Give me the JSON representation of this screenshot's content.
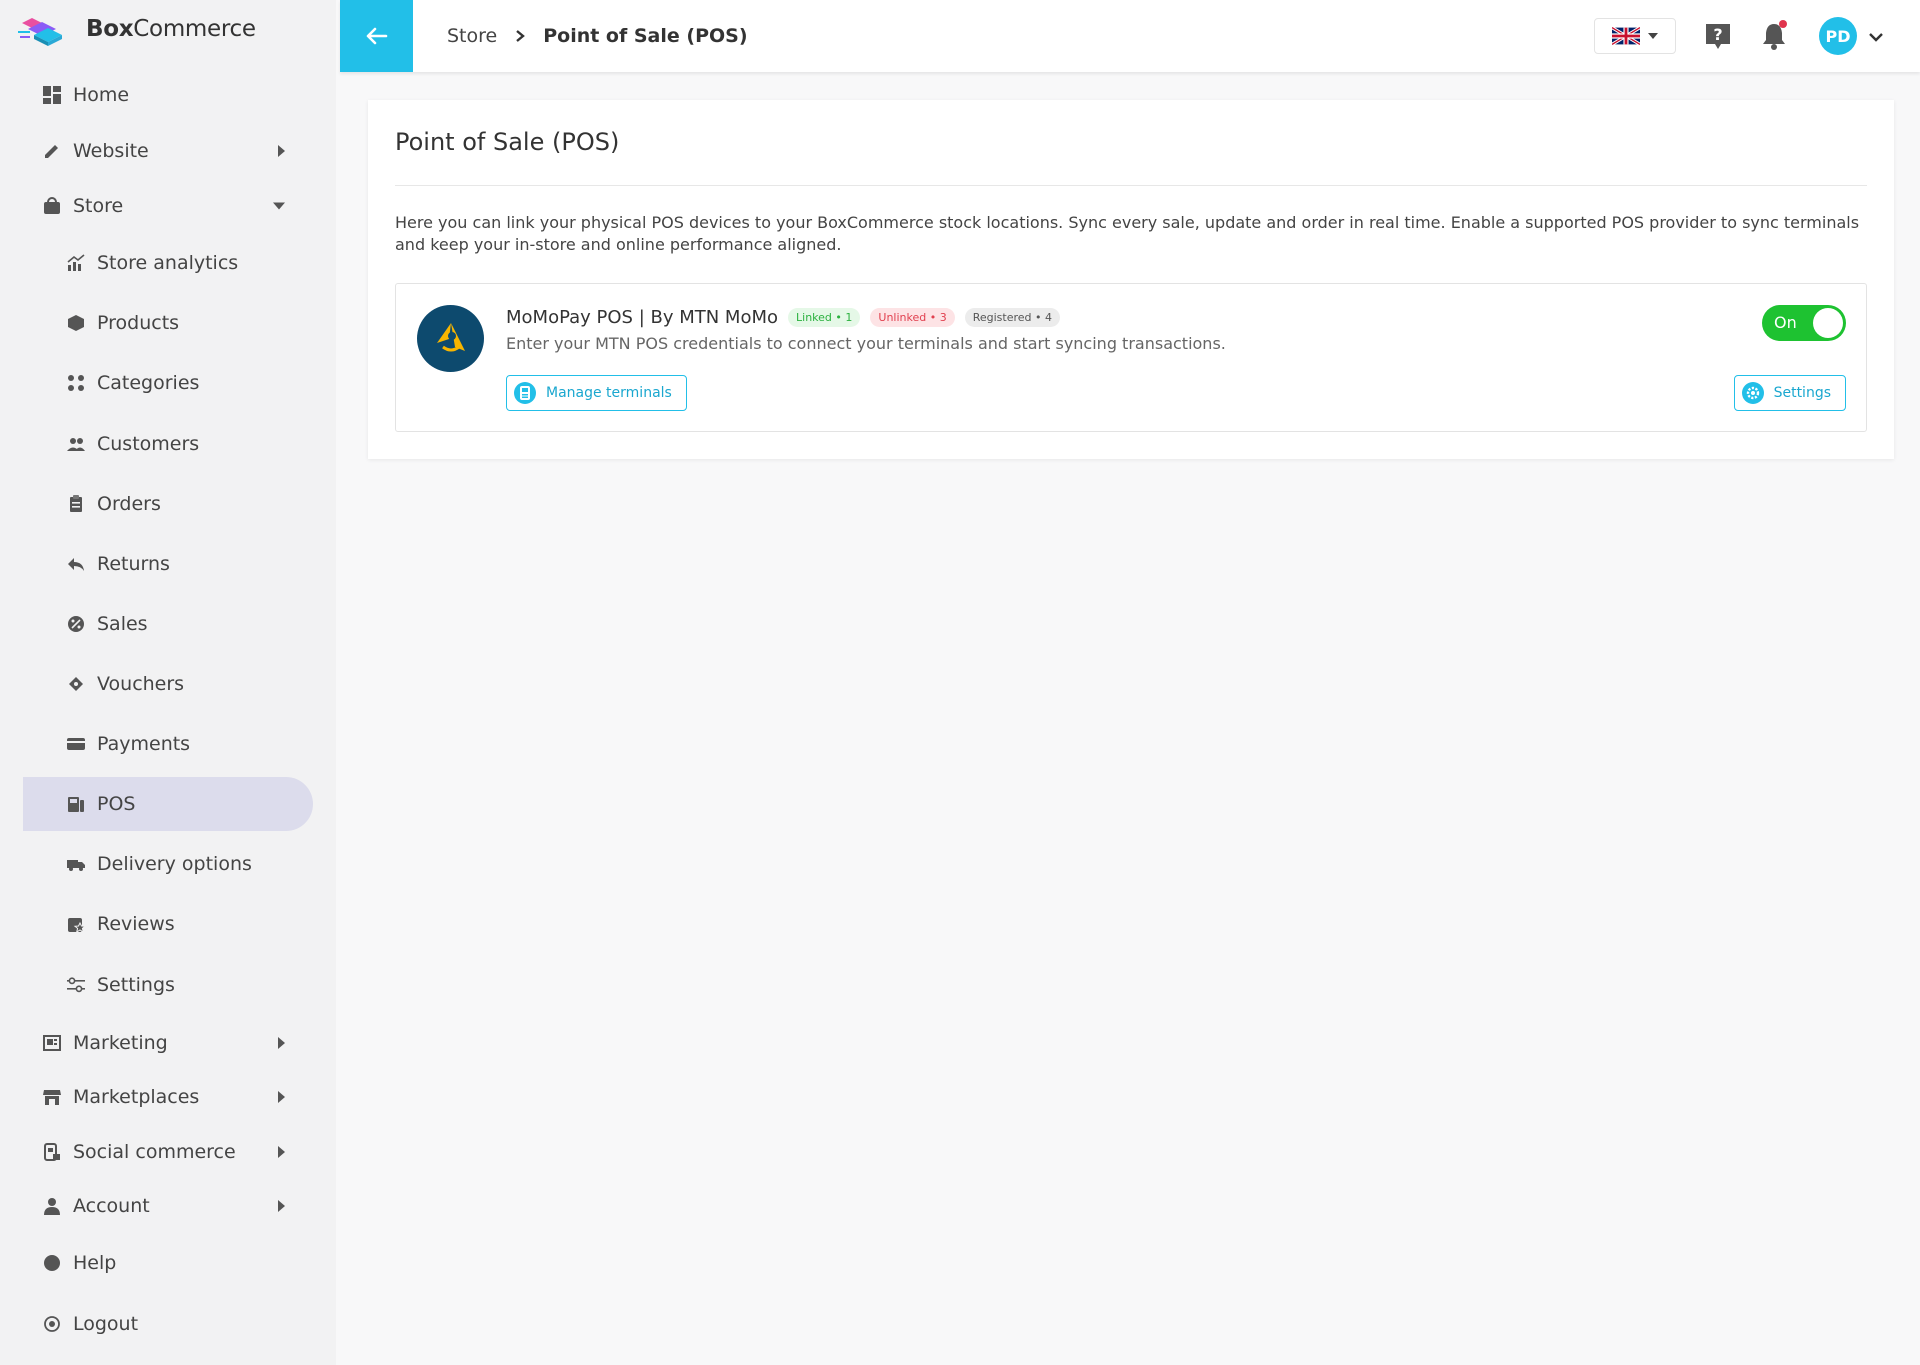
{
  "brand": {
    "name_bold": "Box",
    "name_rest": "Commerce"
  },
  "sidebar": {
    "items": [
      {
        "label": "Home",
        "icon": "dashboard-icon"
      },
      {
        "label": "Website",
        "icon": "pencil-icon"
      },
      {
        "label": "Store",
        "icon": "shopping-bag-icon"
      },
      {
        "label": "Store analytics",
        "icon": "analytics-icon"
      },
      {
        "label": "Products",
        "icon": "box-icon"
      },
      {
        "label": "Categories",
        "icon": "categories-icon"
      },
      {
        "label": "Customers",
        "icon": "people-icon"
      },
      {
        "label": "Orders",
        "icon": "clipboard-icon"
      },
      {
        "label": "Returns",
        "icon": "reply-icon"
      },
      {
        "label": "Sales",
        "icon": "percent-badge-icon"
      },
      {
        "label": "Vouchers",
        "icon": "ticket-icon"
      },
      {
        "label": "Payments",
        "icon": "credit-card-icon"
      },
      {
        "label": "POS",
        "icon": "pos-terminal-icon"
      },
      {
        "label": "Delivery options",
        "icon": "truck-icon"
      },
      {
        "label": "Reviews",
        "icon": "review-star-icon"
      },
      {
        "label": "Settings",
        "icon": "sliders-icon"
      },
      {
        "label": "Marketing",
        "icon": "newspaper-icon"
      },
      {
        "label": "Marketplaces",
        "icon": "storefront-icon"
      },
      {
        "label": "Social commerce",
        "icon": "phone-share-icon"
      },
      {
        "label": "Account",
        "icon": "person-icon"
      },
      {
        "label": "Help",
        "icon": "help-circle-icon"
      },
      {
        "label": "Logout",
        "icon": "logout-icon"
      }
    ]
  },
  "topbar": {
    "breadcrumb": [
      "Store",
      "Point of Sale (POS)"
    ],
    "avatar_initials": "PD",
    "language": "en-GB"
  },
  "page": {
    "title": "Point of Sale (POS)",
    "description": "Here you can link your physical POS devices to your BoxCommerce stock locations. Sync every sale, update and order in real time. Enable a supported POS provider to sync terminals and keep your in-store and online performance aligned."
  },
  "provider": {
    "name": "MoMoPay POS | By MTN MoMo",
    "badges": {
      "linked": "Linked • 1",
      "unlinked": "Unlinked • 3",
      "registered": "Registered • 4"
    },
    "subtitle": "Enter your MTN POS credentials to connect your terminals and start syncing transactions.",
    "manage_label": "Manage terminals",
    "settings_label": "Settings",
    "toggle_label": "On"
  },
  "colors": {
    "accent": "#22bfe8",
    "toggle_on": "#1ec231",
    "active_nav": "#dcdcec"
  }
}
